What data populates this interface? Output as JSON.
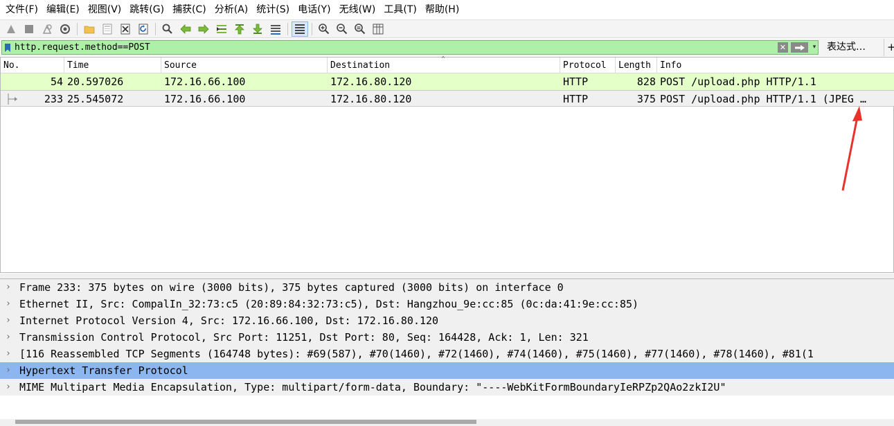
{
  "menu": [
    "文件(F)",
    "编辑(E)",
    "视图(V)",
    "跳转(G)",
    "捕获(C)",
    "分析(A)",
    "统计(S)",
    "电话(Y)",
    "无线(W)",
    "工具(T)",
    "帮助(H)"
  ],
  "toolbar": {
    "icons": [
      "start-capture-icon",
      "stop-capture-icon",
      "restart-capture-icon",
      "capture-options-icon",
      "open-file-icon",
      "save-file-icon",
      "close-file-icon",
      "reload-file-icon",
      "find-packet-icon",
      "go-back-icon",
      "go-forward-icon",
      "go-to-packet-icon",
      "go-first-icon",
      "go-last-icon",
      "autoscroll-icon",
      "colorize-icon",
      "zoom-in-icon",
      "zoom-out-icon",
      "zoom-normal-icon",
      "resize-columns-icon"
    ]
  },
  "filter": {
    "value": "http.request.method==POST",
    "expression_label": "表达式…",
    "plus_label": "+",
    "clear_label": "✕",
    "dropdown_label": "▾"
  },
  "columns": [
    "No.",
    "Time",
    "Source",
    "Destination",
    "Protocol",
    "Length",
    "Info"
  ],
  "packets": [
    {
      "no": "54",
      "time": "20.597026",
      "source": "172.16.66.100",
      "destination": "172.16.80.120",
      "protocol": "HTTP",
      "length": "828",
      "info": "POST /upload.php HTTP/1.1"
    },
    {
      "no": "233",
      "time": "25.545072",
      "source": "172.16.66.100",
      "destination": "172.16.80.120",
      "protocol": "HTTP",
      "length": "375",
      "info": "POST /upload.php HTTP/1.1  (JPEG …"
    }
  ],
  "details": [
    "Frame 233: 375 bytes on wire (3000 bits), 375 bytes captured (3000 bits) on interface 0",
    "Ethernet II, Src: CompalIn_32:73:c5 (20:89:84:32:73:c5), Dst: Hangzhou_9e:cc:85 (0c:da:41:9e:cc:85)",
    "Internet Protocol Version 4, Src: 172.16.66.100, Dst: 172.16.80.120",
    "Transmission Control Protocol, Src Port: 11251, Dst Port: 80, Seq: 164428, Ack: 1, Len: 321",
    "[116 Reassembled TCP Segments (164748 bytes): #69(587), #70(1460), #72(1460), #74(1460), #75(1460), #77(1460), #78(1460), #81(1",
    "Hypertext Transfer Protocol",
    "MIME Multipart Media Encapsulation, Type: multipart/form-data, Boundary: \"----WebKitFormBoundaryIeRPZp2QAo2zkI2U\""
  ],
  "colors": {
    "filter_valid": "#aff0a8",
    "row_http": "#e4ffc7",
    "row_selected": "#f0f0f0",
    "tree_selected": "#8cb6ef",
    "annotation_arrow": "#e8322b"
  }
}
